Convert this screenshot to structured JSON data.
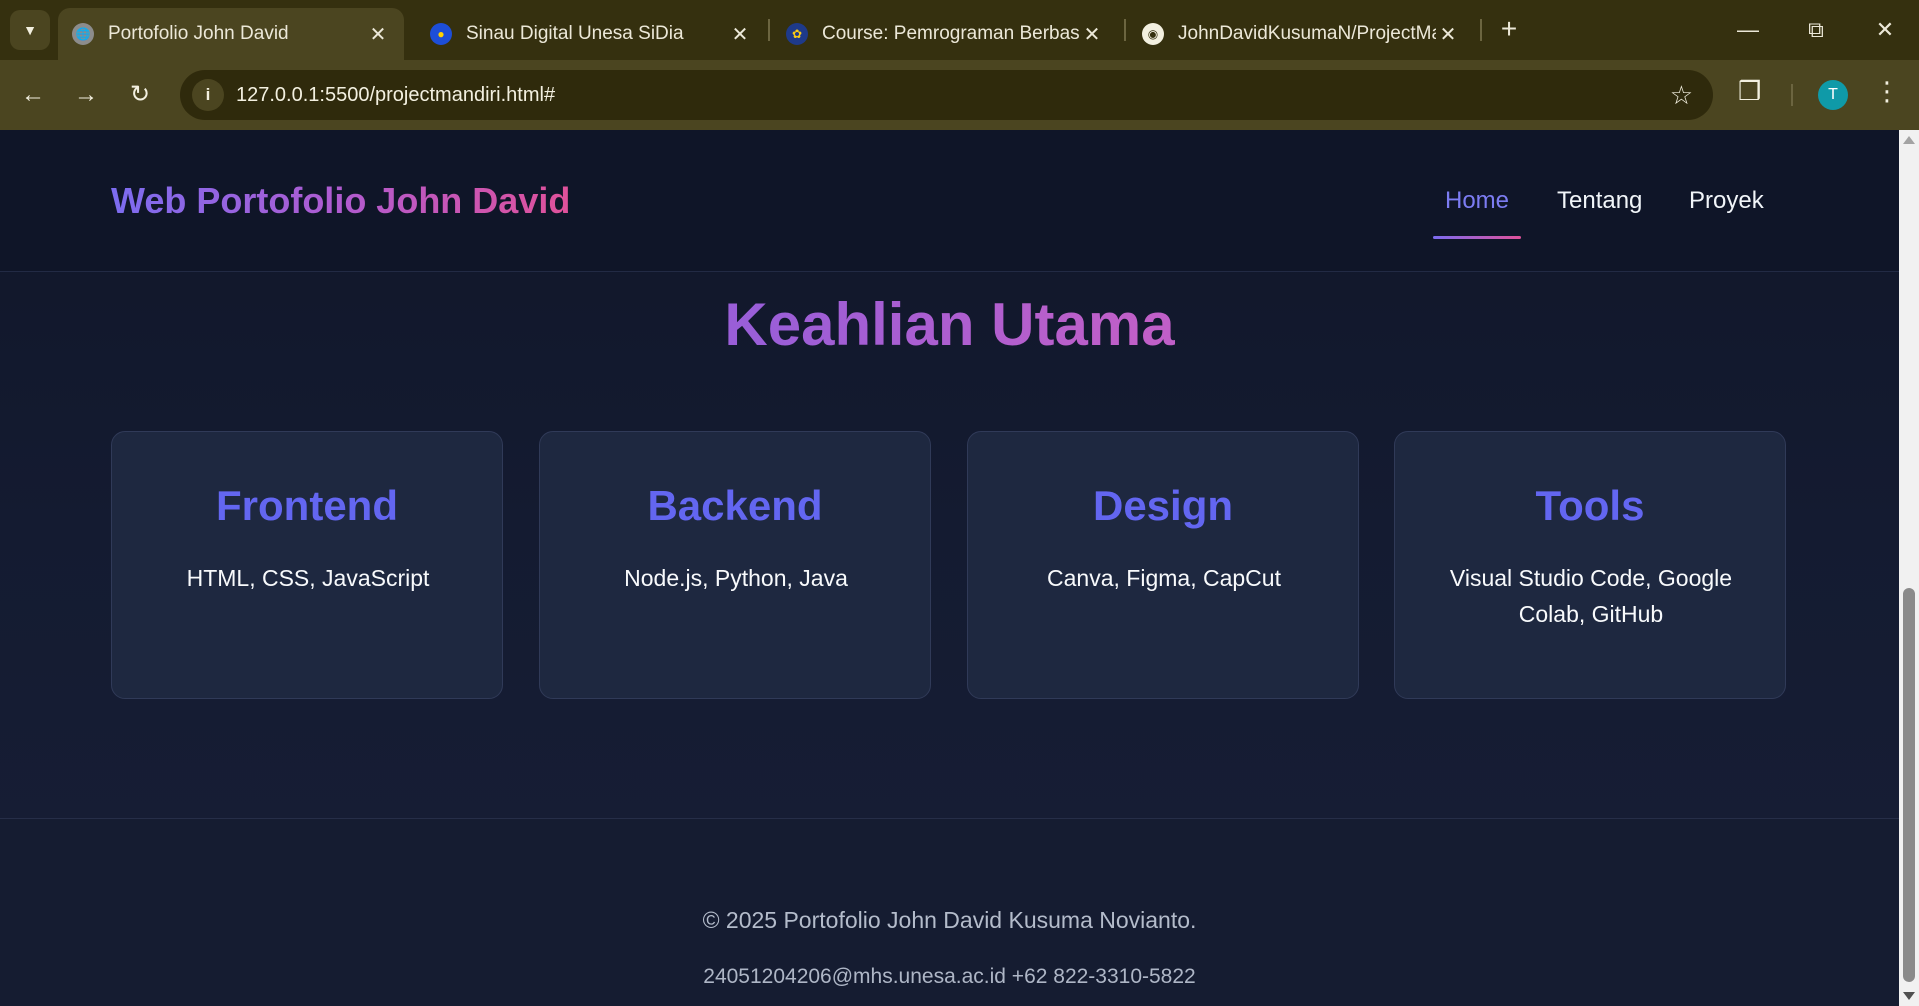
{
  "browser": {
    "tabs": [
      {
        "title": "Portofolio John David",
        "icon": "globe-icon",
        "active": true
      },
      {
        "title": "Sinau Digital Unesa SiDia",
        "icon": "sidia-logo-icon",
        "active": false
      },
      {
        "title": "Course: Pemrograman Berbasis",
        "icon": "unesa-logo-icon",
        "active": false
      },
      {
        "title": "JohnDavidKusumaN/ProjectMa",
        "icon": "github-icon",
        "active": false
      }
    ],
    "url": "127.0.0.1:5500/projectmandiri.html#",
    "profile_initial": "T"
  },
  "site": {
    "brand": "Web Portofolio John David",
    "nav": [
      "Home",
      "Tentang",
      "Proyek"
    ],
    "active_nav": "Home",
    "section_title": "Keahlian Utama",
    "skills": [
      {
        "title": "Frontend",
        "items": "HTML, CSS, JavaScript"
      },
      {
        "title": "Backend",
        "items": "Node.js, Python, Java"
      },
      {
        "title": "Design",
        "items": "Canva, Figma, CapCut"
      },
      {
        "title": "Tools",
        "items": "Visual Studio Code, Google Colab, GitHub"
      }
    ],
    "footer": {
      "copyright": "© 2025 Portofolio John David Kusuma Novianto.",
      "contact": "24051204206@mhs.unesa.ac.id +62 822-3310-5822"
    }
  },
  "colors": {
    "accent": "#6366f1",
    "brand_gradient_start": "#7c6cf0",
    "brand_gradient_end": "#e0519a",
    "page_background": "#151c30",
    "card_background": "#1e2840"
  }
}
